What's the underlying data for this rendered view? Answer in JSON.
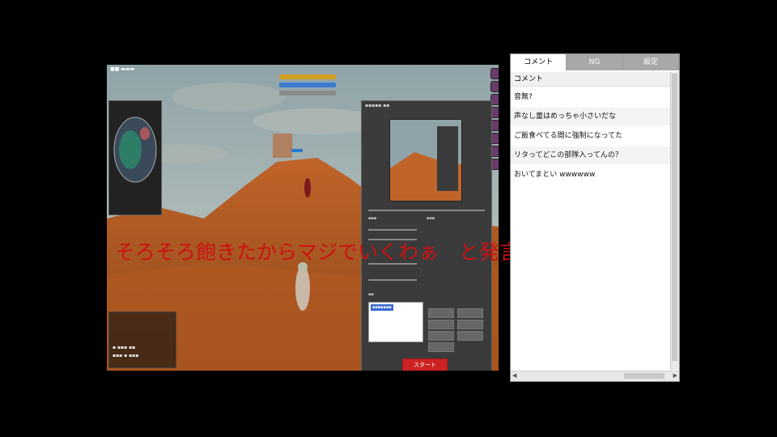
{
  "overlay_comment": "そろそろ飽きたからマジでいくわぁ　と発言します。",
  "comment_panel": {
    "tabs": [
      {
        "label": "コメント",
        "active": true
      },
      {
        "label": "NG",
        "active": false
      },
      {
        "label": "設定",
        "active": false
      }
    ],
    "column_header": "コメント",
    "comments": [
      "音無?",
      "声なし童はめっちゃ小さいだな",
      "ご飯食べてる間に強制になってた",
      "リタってどこの部隊入ってんの？",
      "おいてまとい wwwwww"
    ]
  },
  "game": {
    "start_button_label": "スタート"
  },
  "colors": {
    "overlay_text": "#cc1111",
    "start_button": "#cc2222",
    "tab_inactive": "#a8a8a8",
    "tab_active": "#ffffff"
  }
}
